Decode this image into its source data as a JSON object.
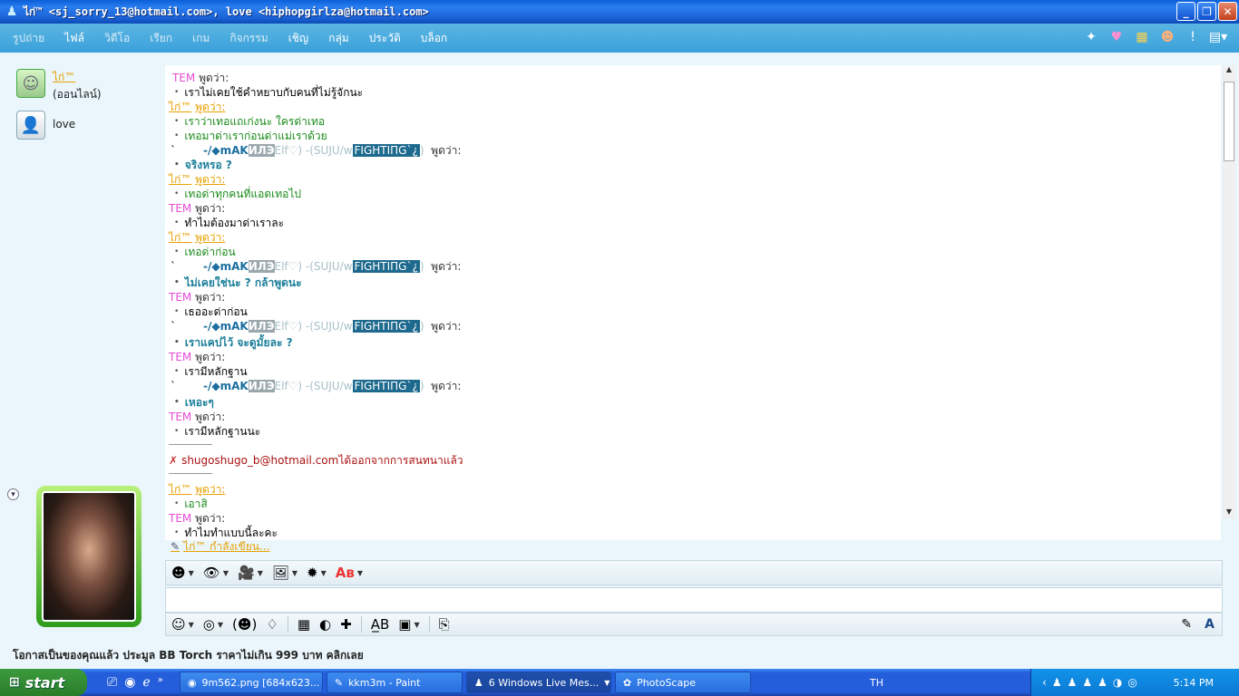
{
  "window": {
    "title": "ไก่™ <sj_sorry_13@hotmail.com>, love <hiphopgirlza@hotmail.com>",
    "buttons": [
      "minimize",
      "restore",
      "close"
    ]
  },
  "menu": {
    "items": [
      {
        "label": "รูปถ่าย",
        "active": false
      },
      {
        "label": "ไฟล์",
        "active": true
      },
      {
        "label": "วิดีโอ",
        "active": false
      },
      {
        "label": "เรียก",
        "active": false
      },
      {
        "label": "เกม",
        "active": false
      },
      {
        "label": "กิจกรรม",
        "active": false
      },
      {
        "label": "เชิญ",
        "active": true
      },
      {
        "label": "กลุ่ม",
        "active": true
      },
      {
        "label": "ประวัติ",
        "active": true
      },
      {
        "label": "บล็อก",
        "active": true
      }
    ],
    "right_icons": [
      "wand-icon",
      "heart-icon",
      "nudge-icon",
      "emoticon-icon",
      "alert-icon",
      "options-menu-icon"
    ]
  },
  "contacts": [
    {
      "name": "ไก่™",
      "status": "(ออนไลน์)"
    },
    {
      "name": "love",
      "status": ""
    }
  ],
  "conversation": {
    "said": "พูดว่า:",
    "tem": "TEM",
    "kai": "ไก่™",
    "mak": {
      "prefix": "`",
      "lead": "-/◆ ",
      "name_a": "mAK",
      "name_b": "ИЛЭ",
      "elf": " Elf♡) -(SUJU/w ",
      "fighting": "FIGHTIПG`¿ ",
      "tail": ")"
    },
    "messages": {
      "m1": "เราไม่เคยใช้คำหยาบกับคนที่ไม่รู้จักนะ",
      "m2": "เราว่าเทอแถเก่งนะ ใครด่าเทอ",
      "m3": "เทอมาด่าเราก่อนด่าแม่เราด้วย",
      "m4": "จริงหรอ ?",
      "m5": "เทอด่าทุกคนที่แอดเทอไป",
      "m6": "ทำไมต้องมาด่าเราละ",
      "m7": "เทอด่าก่อน",
      "m8": "ไม่เคยใช่นะ ? กล้าพูดนะ",
      "m9": "เธออะด่าก่อน",
      "m10": "เราแคปไว้ จะดูมั้ยละ ?",
      "m11": "เรามีหลักฐาน",
      "m12": "เหอะๆ",
      "m13": "เรามีหลักฐานนะ",
      "m14": "เอาสิ",
      "m15": "ทำไมทำแบบนี้ละคะ"
    },
    "leave_email": "shugoshugo_b@hotmail.com",
    "leave_text": " ได้ออกจากการสนทนาแล้ว",
    "typing": "ไก่™ กำลังเขียน..."
  },
  "toolbar_top": [
    "emoticon-icon",
    "wink-icon",
    "video-icon",
    "background-icon",
    "nudge-icon",
    "font-icon"
  ],
  "toolbar_bottom": [
    "smiley-icon",
    "voice-clip-icon",
    "animated-icon",
    "nudge-icon",
    "color-icon",
    "sound-icon",
    "games-icon",
    "spell-icon",
    "activities-icon",
    "send-file-icon"
  ],
  "ad": "โอกาสเป็นของคุณแล้ว ประมูล BB Torch ราคาไม่เกิน 999 บาท คลิกเลย",
  "taskbar": {
    "start": "start",
    "tasks": [
      {
        "label": "9m562.png [684x623...",
        "active": false
      },
      {
        "label": "kkm3m - Paint",
        "active": false
      },
      {
        "label": "6 Windows Live Mes...",
        "active": true
      },
      {
        "label": "PhotoScape",
        "active": false
      }
    ],
    "lang": "TH",
    "clock": "5:14 PM"
  }
}
